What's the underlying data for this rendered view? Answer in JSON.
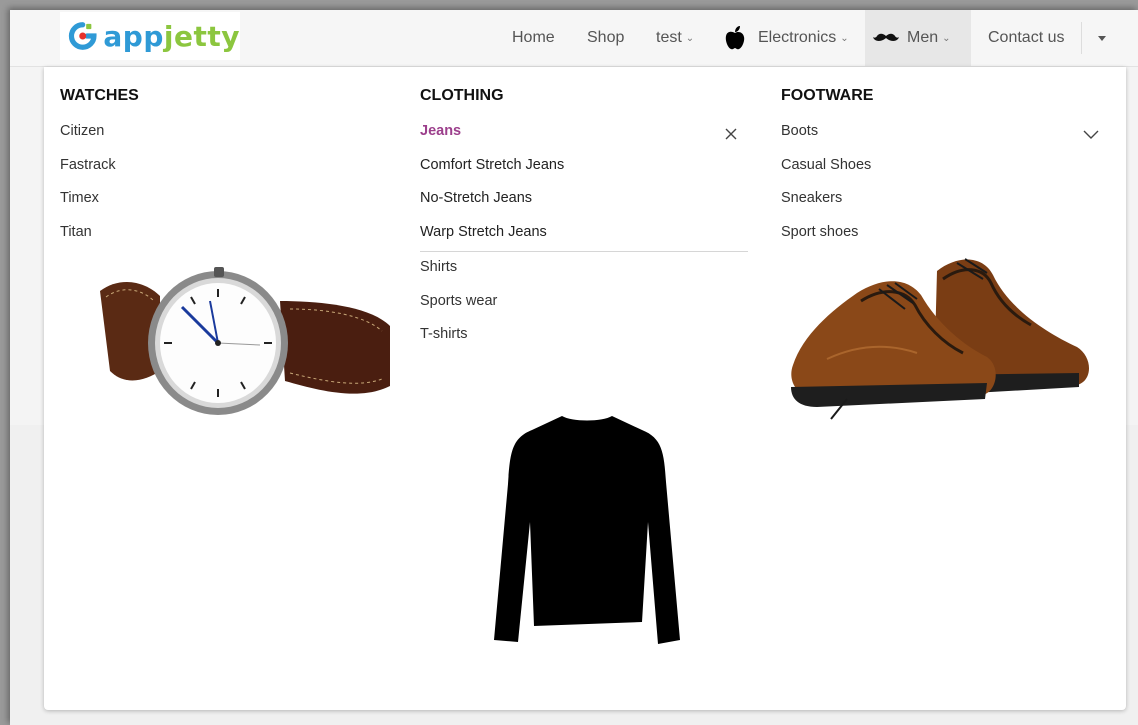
{
  "brand": {
    "text_primary": "app",
    "text_secondary": "jetty",
    "colors": {
      "blue": "#2f9ad6",
      "green": "#8cc63f",
      "red": "#e8322c"
    }
  },
  "nav": {
    "items": [
      {
        "label": "Home"
      },
      {
        "label": "Shop"
      },
      {
        "label": "test",
        "has_dropdown": true
      },
      {
        "label": "Electronics",
        "icon": "apple-icon",
        "has_dropdown": true
      },
      {
        "label": "Men",
        "icon": "mustache-icon",
        "has_dropdown": true,
        "active": true
      },
      {
        "label": "Contact us"
      }
    ],
    "overflow_icon": "caret-down-icon"
  },
  "mega_menu": {
    "columns": [
      {
        "title": "WATCHES",
        "items": [
          "Citizen",
          "Fastrack",
          "Timex",
          "Titan"
        ],
        "image": "wristwatch-image"
      },
      {
        "title": "CLOTHING",
        "items": [
          {
            "label": "Jeans",
            "active": true,
            "expanded": true,
            "icon": "close-icon",
            "subitems": [
              "Comfort Stretch Jeans",
              "No-Stretch Jeans",
              "Warp Stretch Jeans"
            ]
          },
          {
            "label": "Shirts"
          },
          {
            "label": "Sports wear"
          },
          {
            "label": "T-shirts"
          }
        ],
        "image": "sweater-image"
      },
      {
        "title": "FOOTWARE",
        "items": [
          {
            "label": "Boots",
            "icon": "chevron-down-icon"
          },
          {
            "label": "Casual Shoes"
          },
          {
            "label": "Sneakers"
          },
          {
            "label": "Sport shoes"
          }
        ],
        "image": "leather-shoes-image"
      }
    ],
    "accent_color": "#9c3f8c"
  }
}
